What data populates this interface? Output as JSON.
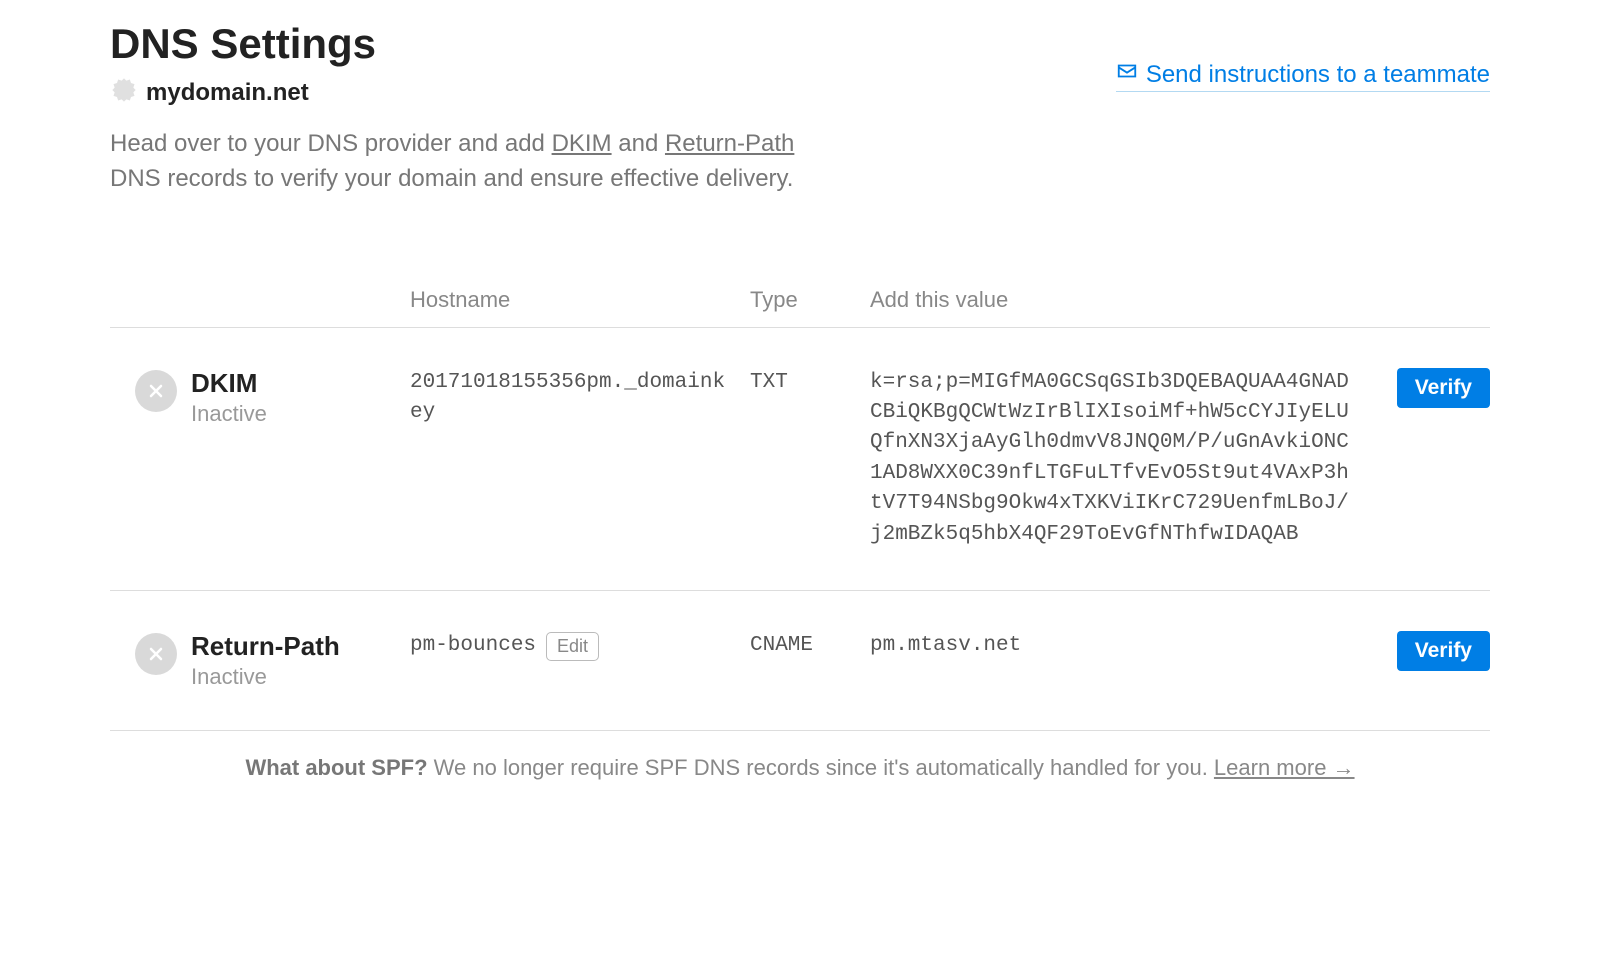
{
  "page": {
    "title": "DNS Settings",
    "domain": "mydomain.net",
    "send_link_label": "Send instructions to a teammate",
    "intro_prefix": "Head over to your DNS provider and add ",
    "intro_link1": "DKIM",
    "intro_middle": " and ",
    "intro_link2": "Return-Path",
    "intro_suffix": " DNS records to verify your domain and ensure effective delivery."
  },
  "table": {
    "headers": {
      "hostname": "Hostname",
      "type": "Type",
      "value": "Add this value"
    }
  },
  "records": [
    {
      "name": "DKIM",
      "status": "Inactive",
      "hostname": "20171018155356pm._domainkey",
      "has_edit": false,
      "type": "TXT",
      "value": "k=rsa;p=MIGfMA0GCSqGSIb3DQEBAQUAA4GNADCBiQKBgQCWtWzIrBlIXIsoiMf+hW5cCYJIyELUQfnXN3XjaAyGlh0dmvV8JNQ0M/P/uGnAvkiONC1AD8WXX0C39nfLTGFuLTfvEvO5St9ut4VAxP3htV7T94NSbg9Okw4xTXKViIKrC729UenfmLBoJ/j2mBZk5q5hbX4QF29ToEvGfNThfwIDAQAB",
      "verify_label": "Verify"
    },
    {
      "name": "Return-Path",
      "status": "Inactive",
      "hostname": "pm-bounces",
      "has_edit": true,
      "edit_label": "Edit",
      "type": "CNAME",
      "value": "pm.mtasv.net",
      "verify_label": "Verify"
    }
  ],
  "footer": {
    "strong": "What about SPF?",
    "text": " We no longer require SPF DNS records since it's automatically handled for you. ",
    "learn_more": "Learn more →"
  }
}
